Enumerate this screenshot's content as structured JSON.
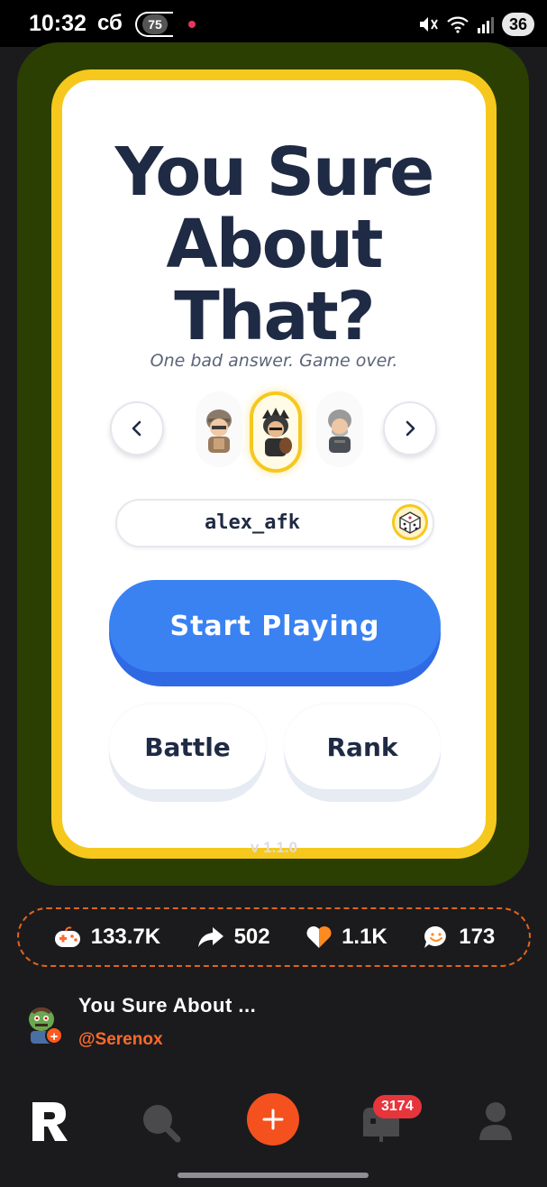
{
  "status_bar": {
    "time": "10:32",
    "day": "сб",
    "notification_count": "75",
    "battery": "36"
  },
  "game": {
    "title_line1": "You Sure",
    "title_line2": "About",
    "title_line3": "That?",
    "subtitle": "One bad answer. Game over.",
    "username": "alex_afk",
    "start_label": "Start Playing",
    "battle_label": "Battle",
    "rank_label": "Rank",
    "version": "v 1.1.0",
    "avatars": [
      "knight-helmet",
      "dark-knight",
      "grey-warrior"
    ],
    "selected_avatar_index": 1
  },
  "stats": {
    "plays": "133.7K",
    "shares": "502",
    "likes": "1.1K",
    "comments": "173"
  },
  "post": {
    "title": "You Sure About ...",
    "author": "@Serenox"
  },
  "nav": {
    "inbox_badge": "3174"
  },
  "colors": {
    "accent_yellow": "#f6c81d",
    "primary_blue": "#3a82f2",
    "brand_orange": "#f4511e",
    "game_bg": "#2b3f03"
  }
}
